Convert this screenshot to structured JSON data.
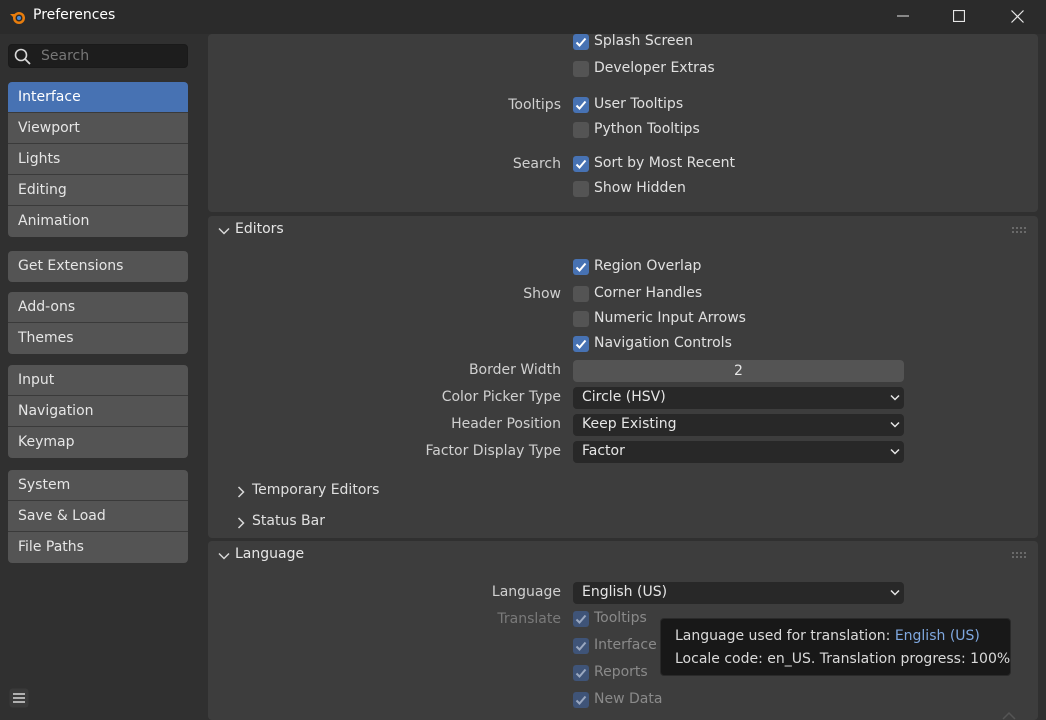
{
  "window": {
    "title": "Preferences",
    "icon": "blender-logo-icon",
    "controls": [
      "minimize-icon",
      "maximize-icon",
      "close-icon"
    ]
  },
  "sidebar": {
    "search_placeholder": "Search",
    "groups": [
      [
        {
          "label": "Interface",
          "active": true
        },
        {
          "label": "Viewport"
        },
        {
          "label": "Lights"
        },
        {
          "label": "Editing"
        },
        {
          "label": "Animation"
        }
      ],
      [
        {
          "label": "Get Extensions"
        }
      ],
      [
        {
          "label": "Add-ons"
        },
        {
          "label": "Themes"
        }
      ],
      [
        {
          "label": "Input"
        },
        {
          "label": "Navigation"
        },
        {
          "label": "Keymap"
        }
      ],
      [
        {
          "label": "System"
        },
        {
          "label": "Save & Load"
        },
        {
          "label": "File Paths"
        }
      ]
    ]
  },
  "display_section": {
    "splash_screen": {
      "label": "Splash Screen",
      "checked": true
    },
    "developer_extras": {
      "label": "Developer Extras",
      "checked": false
    },
    "tooltips_label": "Tooltips",
    "user_tooltips": {
      "label": "User Tooltips",
      "checked": true
    },
    "python_tooltips": {
      "label": "Python Tooltips",
      "checked": false
    },
    "search_label": "Search",
    "sort_by_most_recent": {
      "label": "Sort by Most Recent",
      "checked": true
    },
    "show_hidden": {
      "label": "Show Hidden",
      "checked": false
    }
  },
  "editors": {
    "title": "Editors",
    "region_overlap": {
      "label": "Region Overlap",
      "checked": true
    },
    "show_label": "Show",
    "corner_handles": {
      "label": "Corner Handles",
      "checked": false
    },
    "numeric_input_arrows": {
      "label": "Numeric Input Arrows",
      "checked": false
    },
    "navigation_controls": {
      "label": "Navigation Controls",
      "checked": true
    },
    "border_width": {
      "label": "Border Width",
      "value": "2"
    },
    "color_picker_type": {
      "label": "Color Picker Type",
      "value": "Circle (HSV)"
    },
    "header_position": {
      "label": "Header Position",
      "value": "Keep Existing"
    },
    "factor_display_type": {
      "label": "Factor Display Type",
      "value": "Factor"
    },
    "temporary_editors": "Temporary Editors",
    "status_bar": "Status Bar"
  },
  "language": {
    "title": "Language",
    "language": {
      "label": "Language",
      "value": "English (US)"
    },
    "translate_label": "Translate",
    "tooltips": {
      "label": "Tooltips",
      "checked": true
    },
    "interface": {
      "label": "Interface",
      "checked": true
    },
    "reports": {
      "label": "Reports",
      "checked": true
    },
    "new_data": {
      "label": "New Data",
      "checked": true
    }
  },
  "tooltip": {
    "line1_prefix": "Language used for translation: ",
    "line1_value": "English (US)",
    "line2": "Locale code: en_US. Translation progress: 100%"
  },
  "colors": {
    "accent": "#4772b3",
    "background": "#303030",
    "panel": "#3d3d3d"
  }
}
